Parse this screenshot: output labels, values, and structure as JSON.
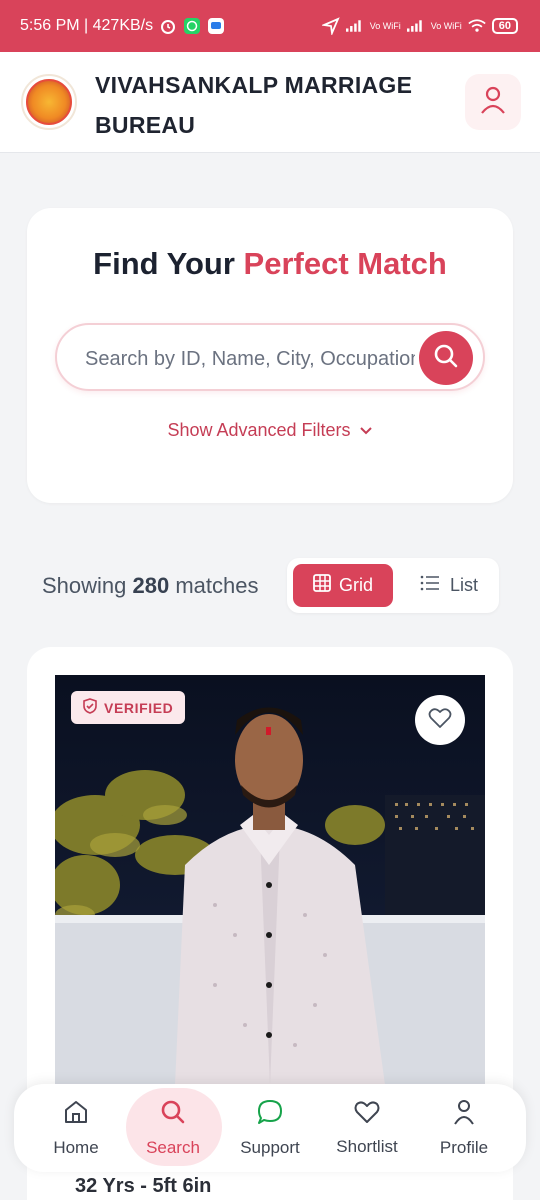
{
  "status_bar": {
    "time_speed": "5:56 PM | 427KB/s",
    "vo_wifi_1": "Vo WiFi",
    "vo_wifi_2": "Vo WiFi",
    "battery": "60"
  },
  "header": {
    "brand_title": "VIVAHSANKALP MARRIAGE BUREAU",
    "logo_icon": "bureau-logo",
    "user_icon": "user-icon"
  },
  "search_card": {
    "title_plain": "Find Your ",
    "title_accent": "Perfect Match",
    "search_placeholder": "Search by ID, Name, City, Occupation",
    "search_value": "",
    "advanced_filters_label": "Show Advanced Filters"
  },
  "results": {
    "showing_prefix": "Showing ",
    "count": "280",
    "suffix": " matches",
    "grid_label": "Grid",
    "list_label": "List",
    "active_view": "Grid"
  },
  "profile_card": {
    "verified_label": "VERIFIED",
    "age_height": "32 Yrs - 5ft 6in"
  },
  "bottom_nav": {
    "items": [
      {
        "label": "Home",
        "icon": "home-icon"
      },
      {
        "label": "Search",
        "icon": "search-icon"
      },
      {
        "label": "Support",
        "icon": "chat-icon"
      },
      {
        "label": "Shortlist",
        "icon": "heart-icon"
      },
      {
        "label": "Profile",
        "icon": "user-icon"
      }
    ],
    "active": "Search"
  },
  "colors": {
    "accent": "#d9435a",
    "accent_light": "#fce4e8",
    "background": "#f3f4f6",
    "text_dark": "#1f2430"
  }
}
